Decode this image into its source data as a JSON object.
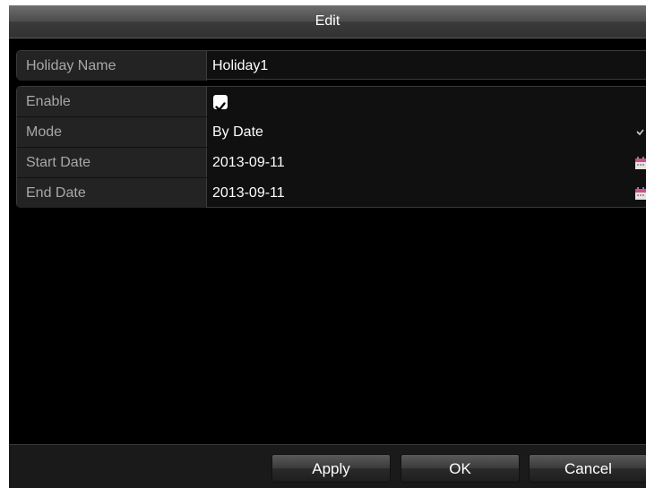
{
  "dialog": {
    "title": "Edit"
  },
  "holiday_name": {
    "label": "Holiday Name",
    "value": "Holiday1"
  },
  "settings": {
    "enable": {
      "label": "Enable",
      "checked": true
    },
    "mode": {
      "label": "Mode",
      "value": "By Date"
    },
    "start_date": {
      "label": "Start Date",
      "value": "2013-09-11"
    },
    "end_date": {
      "label": "End Date",
      "value": "2013-09-11"
    }
  },
  "buttons": {
    "apply": "Apply",
    "ok": "OK",
    "cancel": "Cancel"
  },
  "icons": {
    "checkbox": "checkmark-icon",
    "mode_dropdown": "chevron-down-icon",
    "start_date_picker": "calendar-icon",
    "end_date_picker": "calendar-icon"
  },
  "colors": {
    "background": "#000000",
    "label_bg": "#232323",
    "label_text": "#a8a8a8",
    "value_text": "#ffffff"
  }
}
